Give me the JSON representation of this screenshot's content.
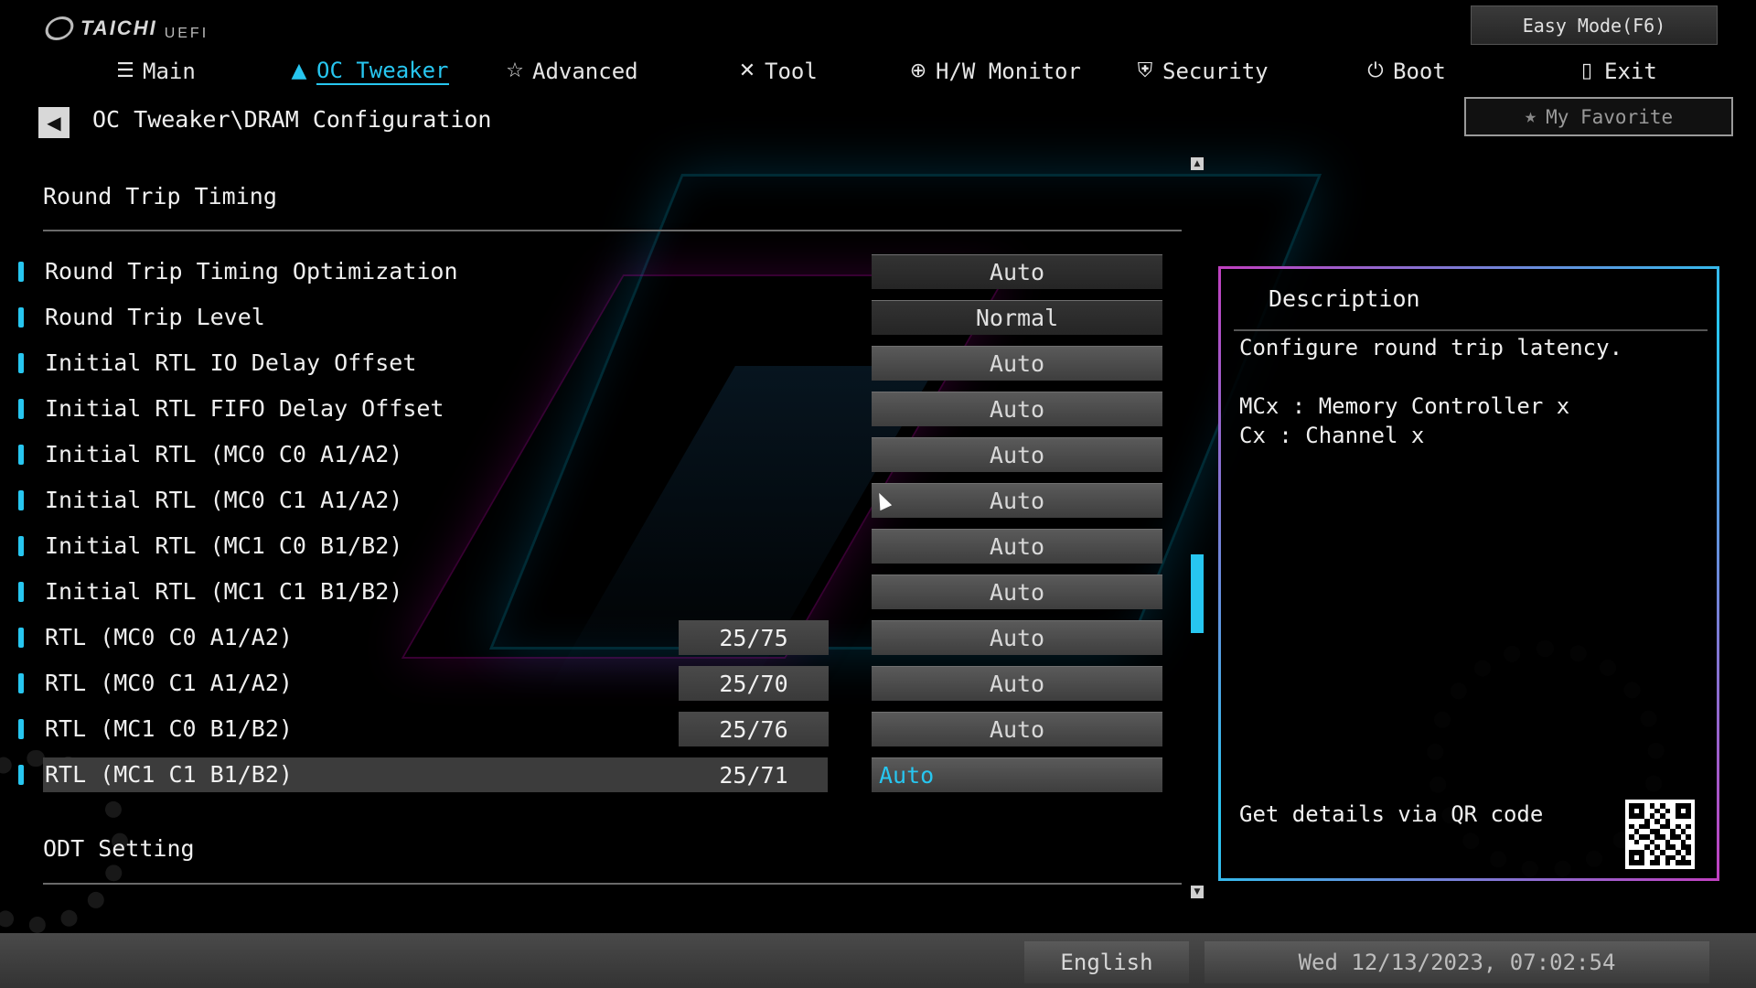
{
  "brand": {
    "name": "TAICHI",
    "sub": "UEFI"
  },
  "top": {
    "easy_mode": "Easy Mode(F6)",
    "my_favorite": "My Favorite"
  },
  "nav": [
    {
      "label": "Main",
      "icon": "list-icon",
      "active": false
    },
    {
      "label": "OC Tweaker",
      "icon": "rocket-icon",
      "active": true
    },
    {
      "label": "Advanced",
      "icon": "star-icon",
      "active": false
    },
    {
      "label": "Tool",
      "icon": "tools-icon",
      "active": false
    },
    {
      "label": "H/W Monitor",
      "icon": "crosshair-icon",
      "active": false
    },
    {
      "label": "Security",
      "icon": "shield-icon",
      "active": false
    },
    {
      "label": "Boot",
      "icon": "power-icon",
      "active": false
    },
    {
      "label": "Exit",
      "icon": "exit-door-icon",
      "active": false
    }
  ],
  "breadcrumb": "OC Tweaker\\DRAM Configuration",
  "sections": {
    "round_trip": "Round Trip Timing",
    "odt": "ODT Setting"
  },
  "rows": [
    {
      "label": "Round Trip Timing Optimization",
      "current": "",
      "value": "Auto"
    },
    {
      "label": "Round Trip Level",
      "current": "",
      "value": "Normal"
    },
    {
      "label": "Initial RTL IO Delay Offset",
      "current": "",
      "value": "Auto"
    },
    {
      "label": "Initial RTL FIFO Delay Offset",
      "current": "",
      "value": "Auto"
    },
    {
      "label": "Initial RTL (MC0 C0 A1/A2)",
      "current": "",
      "value": "Auto"
    },
    {
      "label": "Initial RTL (MC0 C1 A1/A2)",
      "current": "",
      "value": "Auto"
    },
    {
      "label": "Initial RTL (MC1 C0 B1/B2)",
      "current": "",
      "value": "Auto"
    },
    {
      "label": "Initial RTL (MC1 C1 B1/B2)",
      "current": "",
      "value": "Auto"
    },
    {
      "label": "RTL (MC0 C0 A1/A2)",
      "current": "25/75",
      "value": "Auto"
    },
    {
      "label": "RTL (MC0 C1 A1/A2)",
      "current": "25/70",
      "value": "Auto"
    },
    {
      "label": "RTL (MC1 C0 B1/B2)",
      "current": "25/76",
      "value": "Auto"
    },
    {
      "label": "RTL (MC1 C1 B1/B2)",
      "current": "25/71",
      "value": "Auto"
    }
  ],
  "description": {
    "title": "Description",
    "text": "Configure round trip latency.",
    "line1": "MCx : Memory Controller x",
    "line2": "Cx : Channel x",
    "qr_label": "Get details via QR code"
  },
  "footer": {
    "language": "English",
    "datetime": "Wed 12/13/2023, 07:02:54"
  },
  "colors": {
    "accent": "#27c6f0",
    "panel_border": "#c040c0"
  }
}
